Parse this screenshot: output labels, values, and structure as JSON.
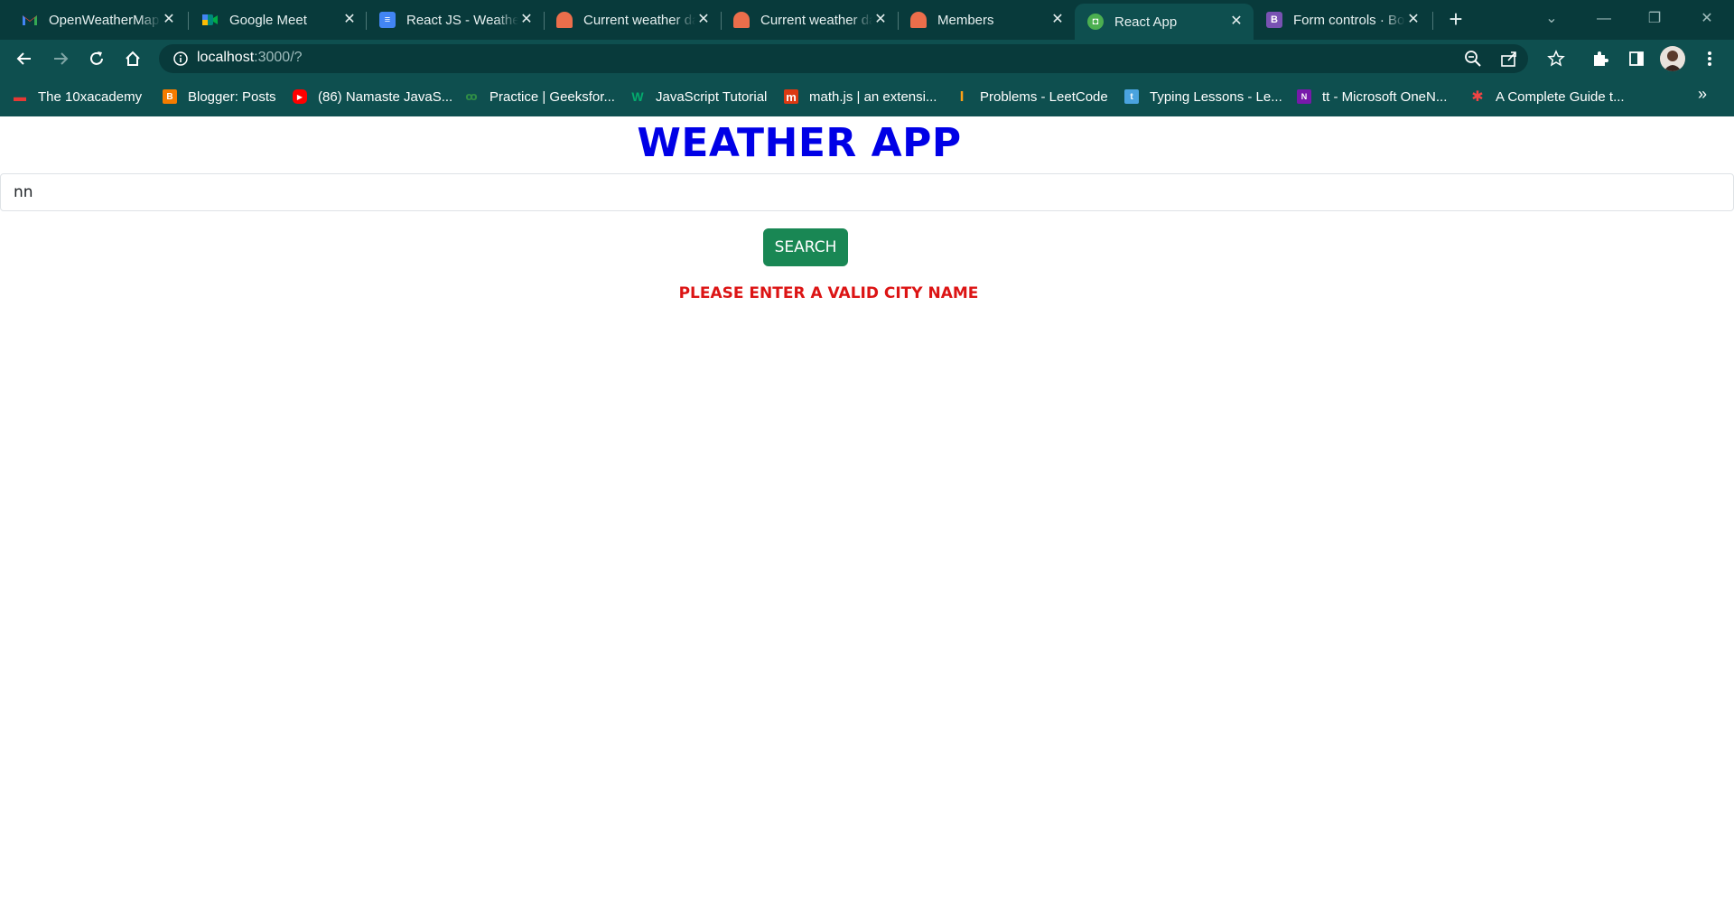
{
  "browser": {
    "tabs": [
      {
        "title": "OpenWeatherMap",
        "favicon": "gmail-icon",
        "color": "#ea4335",
        "active": false
      },
      {
        "title": "Google Meet",
        "favicon": "google-meet-icon",
        "color": "#00897b",
        "active": false
      },
      {
        "title": "React JS - Weather",
        "favicon": "google-docs-icon",
        "color": "#4285f4",
        "active": false
      },
      {
        "title": "Current weather data",
        "favicon": "openweather-icon",
        "color": "#eb6e4b",
        "active": false
      },
      {
        "title": "Current weather data",
        "favicon": "openweather-icon",
        "color": "#eb6e4b",
        "active": false
      },
      {
        "title": "Members",
        "favicon": "openweather-icon",
        "color": "#eb6e4b",
        "active": false
      },
      {
        "title": "React App",
        "favicon": "react-app-icon",
        "color": "#4caf50",
        "active": true
      },
      {
        "title": "Form controls · Bootstrap",
        "favicon": "bootstrap-icon",
        "color": "#7952b3",
        "active": false
      }
    ],
    "address": {
      "host": "localhost",
      "path": ":3000/?"
    },
    "bookmarks": [
      {
        "label": "The 10xacademy",
        "icon": "10x-icon",
        "color": "#e53935",
        "glyph": "▬"
      },
      {
        "label": "Blogger: Posts",
        "icon": "blogger-icon",
        "color": "#f57c00",
        "glyph": "B"
      },
      {
        "label": "(86) Namaste JavaS...",
        "icon": "youtube-icon",
        "color": "#ff0000",
        "glyph": "▶"
      },
      {
        "label": "Practice | Geeksfor...",
        "icon": "geeksforgeeks-icon",
        "color": "#2f8d46",
        "glyph": "G"
      },
      {
        "label": "JavaScript Tutorial",
        "icon": "w3schools-icon",
        "color": "#04aa6d",
        "glyph": "W"
      },
      {
        "label": "math.js | an extensi...",
        "icon": "mathjs-icon",
        "color": "#dc3912",
        "glyph": "m"
      },
      {
        "label": "Problems - LeetCode",
        "icon": "leetcode-icon",
        "color": "#ffa116",
        "glyph": "L"
      },
      {
        "label": "Typing Lessons - Le...",
        "icon": "typing-icon",
        "color": "#4aa3df",
        "glyph": "t"
      },
      {
        "label": "tt - Microsoft OneN...",
        "icon": "onenote-icon",
        "color": "#7719aa",
        "glyph": "N"
      },
      {
        "label": "A Complete Guide t...",
        "icon": "css-tricks-icon",
        "color": "#ef4444",
        "glyph": "✱"
      }
    ],
    "bookmarks_overflow": "»"
  },
  "app": {
    "title": "WEATHER APP",
    "search": {
      "value": "nn",
      "placeholder": ""
    },
    "search_button": "SEARCH",
    "error": "PLEASE ENTER A VALID CITY NAME",
    "colors": {
      "title": "#0000e6",
      "button": "#198754",
      "error": "#dc1414"
    }
  }
}
